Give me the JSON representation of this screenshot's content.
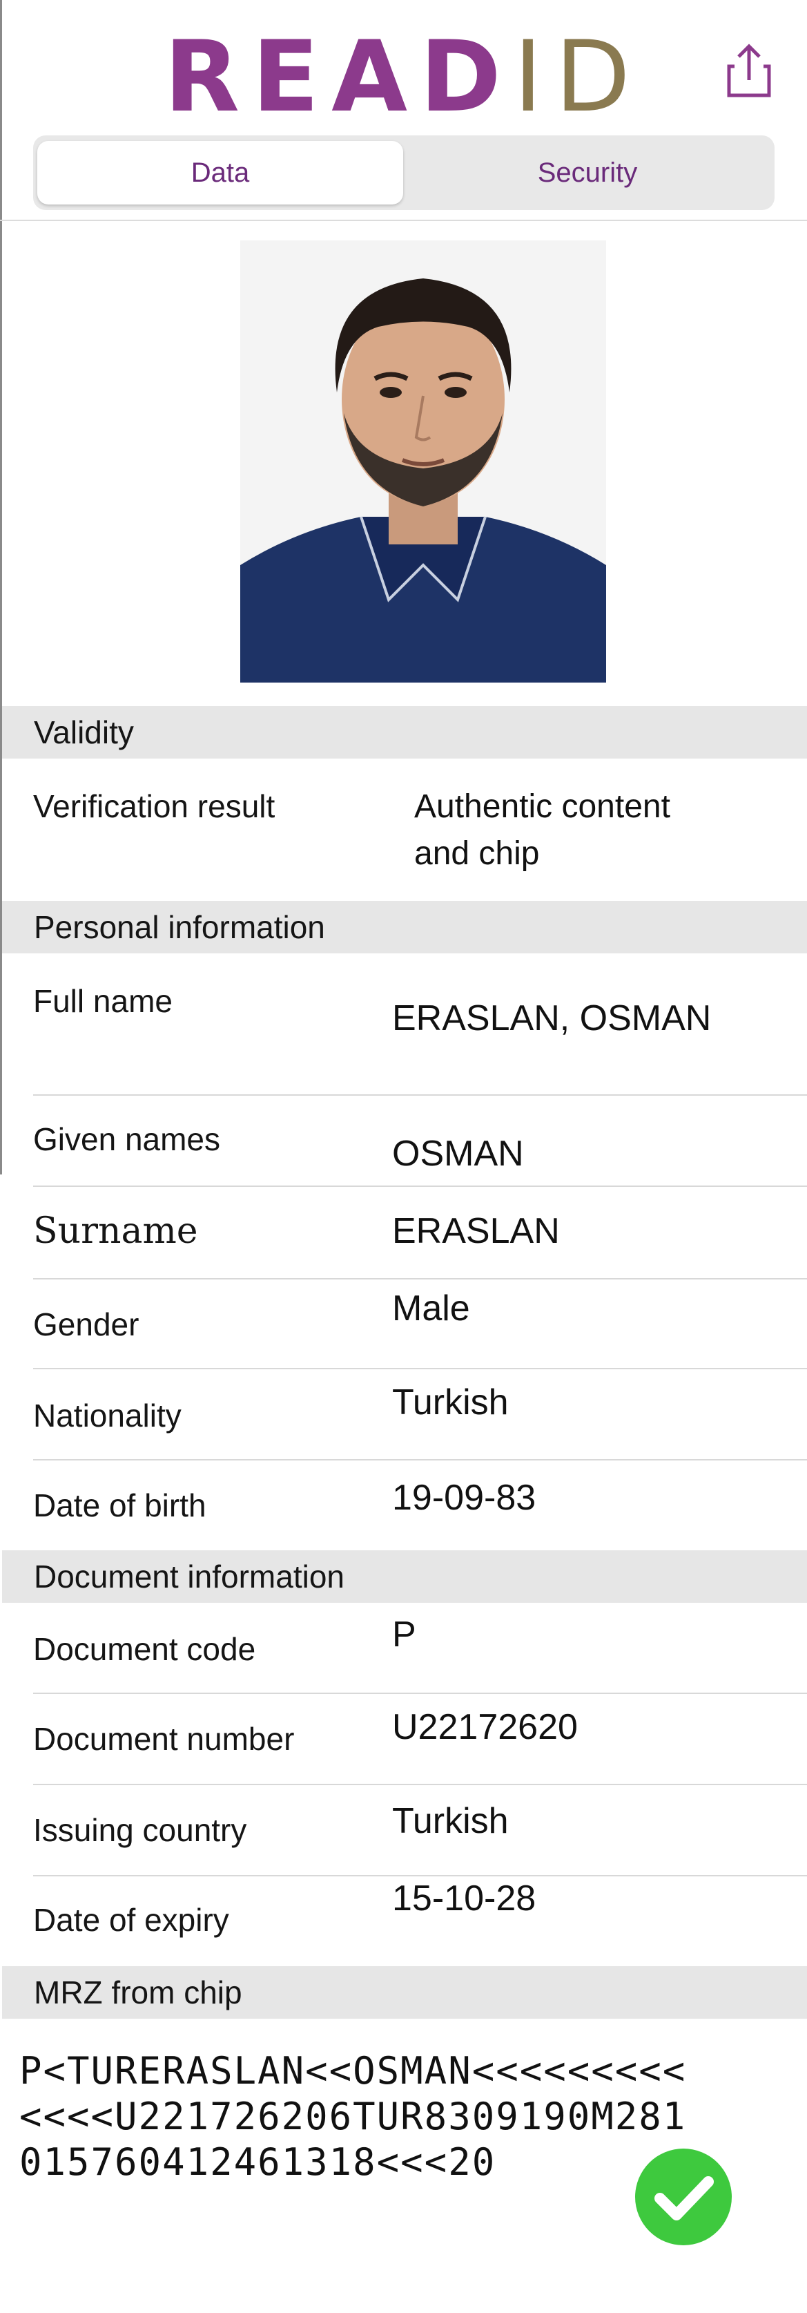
{
  "header": {
    "logo_read": "READ",
    "logo_id": "ID",
    "share_icon": "share-icon",
    "tabs": [
      {
        "label": "Data",
        "selected": true
      },
      {
        "label": "Security",
        "selected": false
      }
    ]
  },
  "colors": {
    "brand_purple": "#8c3a8c",
    "brand_gold": "#8a7a50",
    "success_green": "#3ec93e",
    "section_bg": "#e6e6e6"
  },
  "validity": {
    "title": "Validity",
    "verification_label": "Verification result",
    "verification_value_line1": "Authentic content",
    "verification_value_line2": "and chip"
  },
  "personal": {
    "title": "Personal information",
    "full_name_label": "Full name",
    "full_name_value": "ERASLAN, OSMAN",
    "given_label": "Given names",
    "given_value": "OSMAN",
    "surname_label": "Surname",
    "surname_value": "ERASLAN",
    "gender_label": "Gender",
    "gender_value": "Male",
    "nationality_label": "Nationality",
    "nationality_value": "Turkish",
    "dob_label": "Date of birth",
    "dob_value": "19-09-83"
  },
  "document": {
    "title": "Document information",
    "code_label": "Document code",
    "code_value": "P",
    "number_label": "Document number",
    "number_value": "U22172620",
    "country_label": "Issuing country",
    "country_value": "Turkish",
    "expiry_label": "Date of expiry",
    "expiry_value": "15-10-28"
  },
  "mrz": {
    "title": "MRZ from chip",
    "line1": "P<TURERASLAN<<OSMAN<<<<<<<<<",
    "line2": "<<<<U221726206TUR8309190M281",
    "line3": "015760412461318<<<20",
    "status_icon": "checkmark-icon"
  }
}
